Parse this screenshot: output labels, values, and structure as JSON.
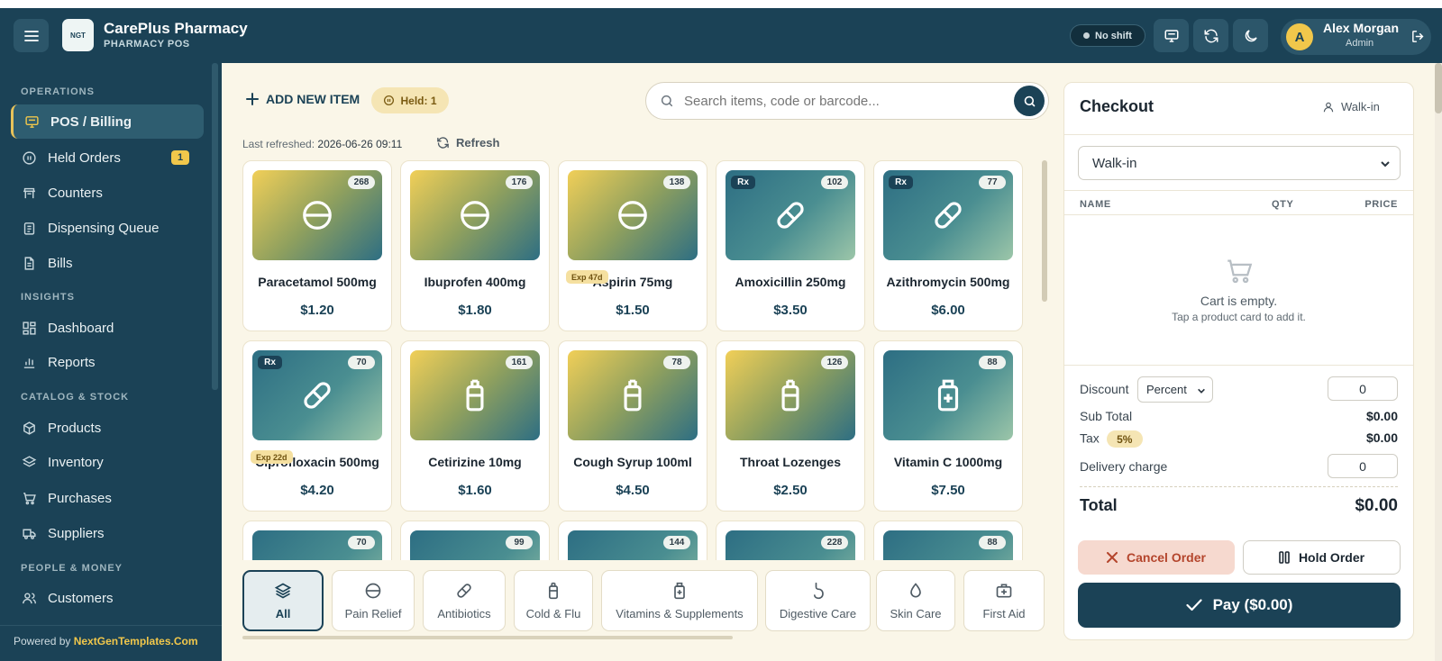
{
  "app": {
    "name": "CarePlus Pharmacy",
    "subtitle": "PHARMACY POS",
    "logo_text": "NGT"
  },
  "topbar": {
    "shift_status": "No shift",
    "user_name": "Alex Morgan",
    "user_role": "Admin",
    "avatar_letter": "A"
  },
  "sidebar": {
    "sections": [
      "OPERATIONS",
      "INSIGHTS",
      "CATALOG & STOCK",
      "PEOPLE & MONEY"
    ],
    "items": [
      {
        "label": "POS / Billing",
        "icon": "monitor-icon",
        "active": true
      },
      {
        "label": "Held Orders",
        "icon": "pause-circle-icon",
        "badge": "1"
      },
      {
        "label": "Counters",
        "icon": "counter-icon"
      },
      {
        "label": "Dispensing Queue",
        "icon": "clipboard-icon"
      },
      {
        "label": "Bills",
        "icon": "receipt-icon"
      },
      {
        "label": "Dashboard",
        "icon": "dashboard-icon"
      },
      {
        "label": "Reports",
        "icon": "bar-chart-icon"
      },
      {
        "label": "Products",
        "icon": "box-icon"
      },
      {
        "label": "Inventory",
        "icon": "layers-icon"
      },
      {
        "label": "Purchases",
        "icon": "cart-icon"
      },
      {
        "label": "Suppliers",
        "icon": "truck-icon"
      },
      {
        "label": "Customers",
        "icon": "users-icon"
      }
    ],
    "footer_prefix": "Powered by",
    "footer_link": "NextGenTemplates.Com"
  },
  "toolbar": {
    "add_new_label": "ADD NEW ITEM",
    "held_label": "Held: 1",
    "search_placeholder": "Search items, code or barcode...",
    "last_refreshed_label": "Last refreshed:",
    "last_refreshed_value": "2026-06-26 09:11",
    "refresh_label": "Refresh"
  },
  "products": [
    {
      "name": "Paracetamol 500mg",
      "price": "$1.20",
      "stock": "268",
      "icon": "tablet-icon",
      "theme": "warm",
      "rx": false,
      "exp": ""
    },
    {
      "name": "Ibuprofen 400mg",
      "price": "$1.80",
      "stock": "176",
      "icon": "tablet-icon",
      "theme": "warm",
      "rx": false,
      "exp": ""
    },
    {
      "name": "Aspirin 75mg",
      "price": "$1.50",
      "stock": "138",
      "icon": "tablet-icon",
      "theme": "warm",
      "rx": false,
      "exp": "Exp 47d"
    },
    {
      "name": "Amoxicillin 250mg",
      "price": "$3.50",
      "stock": "102",
      "icon": "capsule-icon",
      "theme": "cool",
      "rx": true,
      "exp": ""
    },
    {
      "name": "Azithromycin 500mg",
      "price": "$6.00",
      "stock": "77",
      "icon": "capsule-icon",
      "theme": "cool",
      "rx": true,
      "exp": ""
    },
    {
      "name": "Ciprofloxacin 500mg",
      "price": "$4.20",
      "stock": "70",
      "icon": "capsule-icon",
      "theme": "cool",
      "rx": true,
      "exp": "Exp 22d"
    },
    {
      "name": "Cetirizine 10mg",
      "price": "$1.60",
      "stock": "161",
      "icon": "bottle-icon",
      "theme": "warm",
      "rx": false,
      "exp": ""
    },
    {
      "name": "Cough Syrup 100ml",
      "price": "$4.50",
      "stock": "78",
      "icon": "bottle-icon",
      "theme": "warm",
      "rx": false,
      "exp": ""
    },
    {
      "name": "Throat Lozenges",
      "price": "$2.50",
      "stock": "126",
      "icon": "bottle-icon",
      "theme": "warm",
      "rx": false,
      "exp": ""
    },
    {
      "name": "Vitamin C 1000mg",
      "price": "$7.50",
      "stock": "88",
      "icon": "vitamin-bottle-icon",
      "theme": "cool",
      "rx": false,
      "exp": ""
    },
    {
      "name": "",
      "price": "",
      "stock": "70",
      "icon": "",
      "theme": "cool",
      "rx": false,
      "exp": ""
    },
    {
      "name": "",
      "price": "",
      "stock": "99",
      "icon": "",
      "theme": "cool",
      "rx": false,
      "exp": ""
    },
    {
      "name": "",
      "price": "",
      "stock": "144",
      "icon": "",
      "theme": "cool",
      "rx": false,
      "exp": ""
    },
    {
      "name": "",
      "price": "",
      "stock": "228",
      "icon": "",
      "theme": "cool",
      "rx": false,
      "exp": ""
    },
    {
      "name": "",
      "price": "",
      "stock": "88",
      "icon": "",
      "theme": "cool",
      "rx": false,
      "exp": ""
    }
  ],
  "categories": [
    {
      "label": "All",
      "icon": "layers-icon",
      "active": true
    },
    {
      "label": "Pain Relief",
      "icon": "tablet-icon"
    },
    {
      "label": "Antibiotics",
      "icon": "capsule-icon"
    },
    {
      "label": "Cold & Flu",
      "icon": "bottle-icon"
    },
    {
      "label": "Vitamins & Supplements",
      "icon": "vitamin-bottle-icon"
    },
    {
      "label": "Digestive Care",
      "icon": "stomach-icon"
    },
    {
      "label": "Skin Care",
      "icon": "droplet-icon"
    },
    {
      "label": "First Aid",
      "icon": "first-aid-icon"
    }
  ],
  "checkout": {
    "title": "Checkout",
    "customer_chip": "Walk-in",
    "customer_select": "Walk-in",
    "col_name": "NAME",
    "col_qty": "QTY",
    "col_price": "PRICE",
    "empty_title": "Cart is empty.",
    "empty_sub": "Tap a product card to add it.",
    "discount_label": "Discount",
    "discount_type": "Percent",
    "discount_value": "0",
    "subtotal_label": "Sub Total",
    "subtotal_value": "$0.00",
    "tax_label": "Tax",
    "tax_rate": "5%",
    "tax_value": "$0.00",
    "delivery_label": "Delivery charge",
    "delivery_value": "0",
    "total_label": "Total",
    "total_value": "$0.00",
    "cancel_label": "Cancel Order",
    "hold_label": "Hold Order",
    "pay_label": "Pay ($0.00)"
  },
  "colors": {
    "primary": "#1b4256",
    "accent": "#f1c74b",
    "background": "#faf6e8",
    "danger": "#b4452c"
  }
}
